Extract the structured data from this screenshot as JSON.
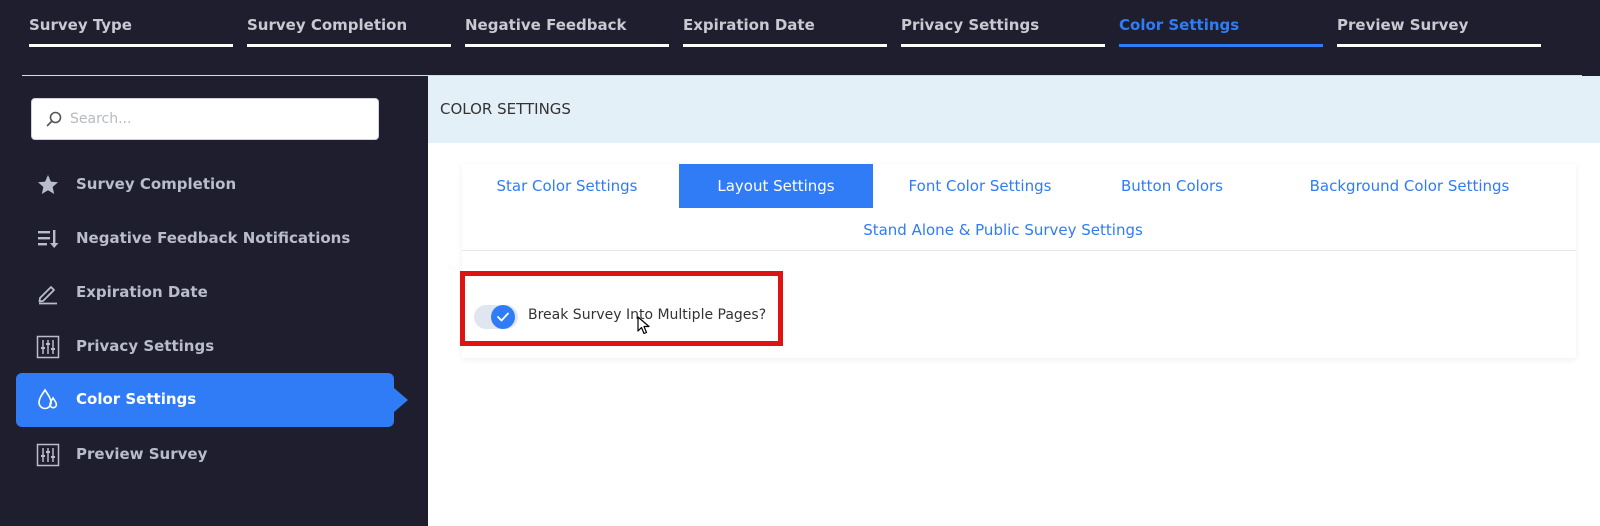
{
  "steps": [
    {
      "label": "Survey Type",
      "active": false
    },
    {
      "label": "Survey Completion",
      "active": false
    },
    {
      "label": "Negative Feedback",
      "active": false
    },
    {
      "label": "Expiration Date",
      "active": false
    },
    {
      "label": "Privacy Settings",
      "active": false
    },
    {
      "label": "Color Settings",
      "active": true
    },
    {
      "label": "Preview Survey",
      "active": false
    }
  ],
  "sidebar": {
    "search_placeholder": "Search...",
    "items": [
      {
        "label": "Survey Completion",
        "icon": "star-icon",
        "active": false
      },
      {
        "label": "Negative Feedback Notifications",
        "icon": "sort-list-icon",
        "active": false
      },
      {
        "label": "Expiration Date",
        "icon": "pen-icon",
        "active": false
      },
      {
        "label": "Privacy Settings",
        "icon": "sliders-icon",
        "active": false
      },
      {
        "label": "Color Settings",
        "icon": "drops-icon",
        "active": true
      },
      {
        "label": "Preview Survey",
        "icon": "sliders-icon",
        "active": false
      }
    ]
  },
  "main": {
    "header_title": "COLOR SETTINGS",
    "tabs": [
      {
        "label": "Star Color Settings",
        "active": false
      },
      {
        "label": "Layout Settings",
        "active": true
      },
      {
        "label": "Font Color Settings",
        "active": false
      },
      {
        "label": "Button Colors",
        "active": false
      },
      {
        "label": "Background Color Settings",
        "active": false
      },
      {
        "label": "Stand Alone & Public Survey Settings",
        "active": false
      }
    ],
    "toggle": {
      "label": "Break Survey Into Multiple Pages?",
      "checked": true
    }
  },
  "colors": {
    "accent": "#2f7cf6",
    "dark_bg": "#1f1e2e",
    "highlight": "#e01313",
    "header_bg": "#e4f0f8"
  }
}
